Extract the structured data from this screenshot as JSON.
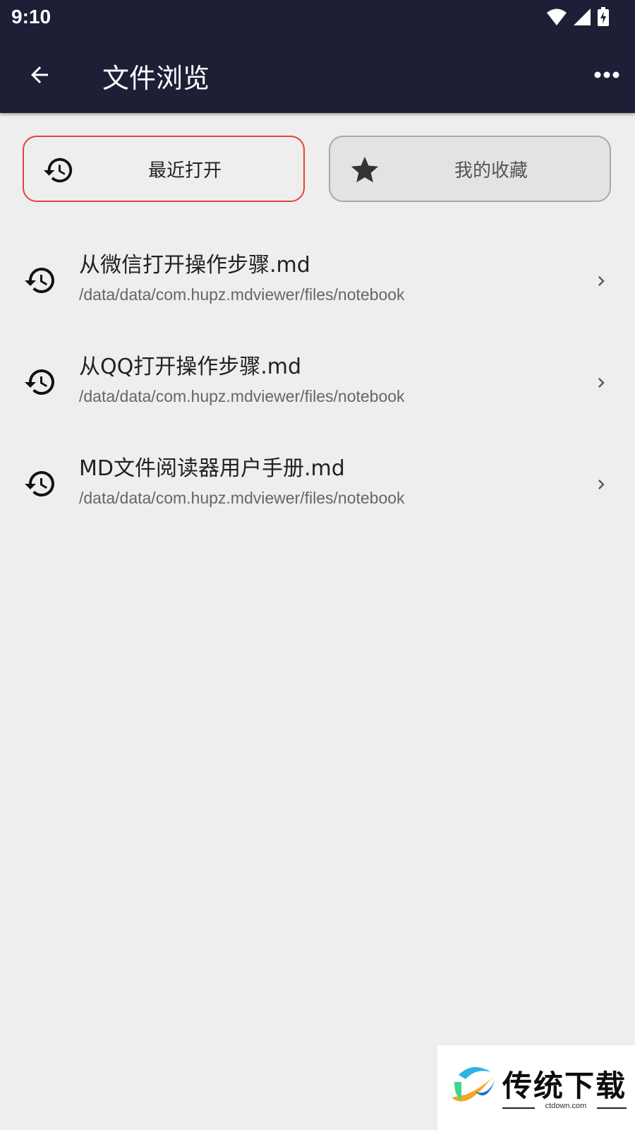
{
  "status_bar": {
    "time": "9:10",
    "icons": [
      "wifi-icon",
      "signal-icon",
      "battery-charging-icon"
    ]
  },
  "app_bar": {
    "title": "文件浏览",
    "back_icon": "arrow-back-icon",
    "more_icon": "more-horiz-icon"
  },
  "tabs": [
    {
      "label": "最近打开",
      "icon": "history-icon",
      "selected": true
    },
    {
      "label": "我的收藏",
      "icon": "star-icon",
      "selected": false
    }
  ],
  "files": [
    {
      "name": "从微信打开操作步骤.md",
      "path": "/data/data/com.hupz.mdviewer/files/notebook"
    },
    {
      "name": "从QQ打开操作步骤.md",
      "path": "/data/data/com.hupz.mdviewer/files/notebook"
    },
    {
      "name": "MD文件阅读器用户手册.md",
      "path": "/data/data/com.hupz.mdviewer/files/notebook"
    }
  ],
  "watermark": {
    "text": "传统下载",
    "sub": "ctdown.com"
  },
  "colors": {
    "app_bar": "#1e1f36",
    "background": "#eeeeee",
    "selected_border": "#e8403a"
  }
}
